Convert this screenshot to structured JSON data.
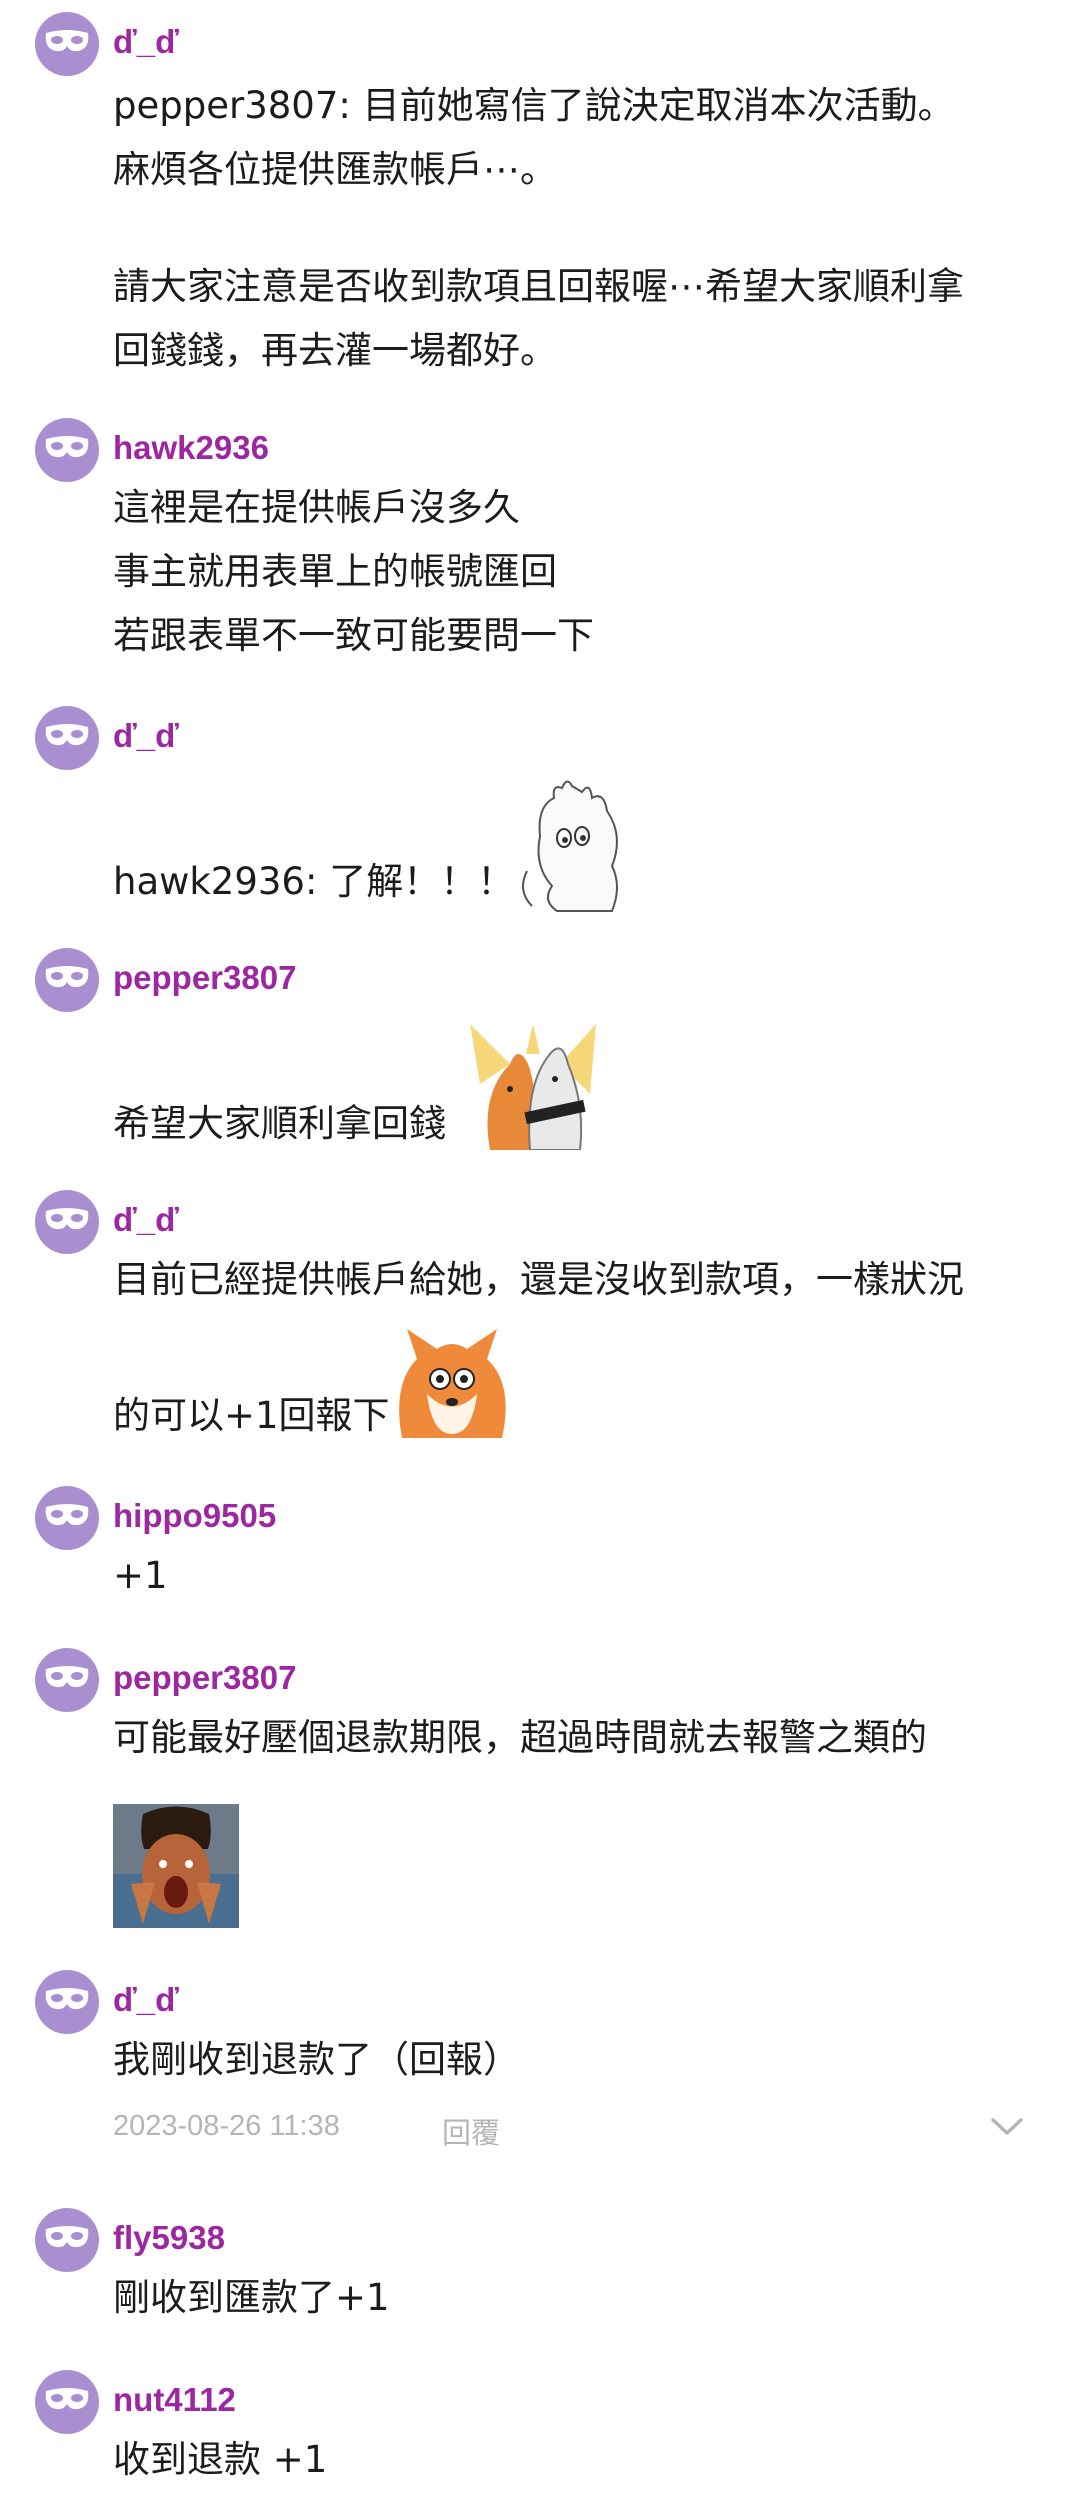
{
  "comments": [
    {
      "user": "ď_ď",
      "lines": [
        "pepper3807: 目前她寫信了說決定取消本次活動。",
        "麻煩各位提供匯款帳戶⋯。",
        "",
        "請大家注意是否收到款項且回報喔⋯希望大家順利拿",
        "回錢錢，再去灌一場都好。"
      ]
    },
    {
      "user": "hawk2936",
      "lines": [
        "這裡是在提供帳戶沒多久",
        "事主就用表單上的帳號匯回",
        "若跟表單不一致可能要問一下"
      ]
    },
    {
      "user": "ď_ď",
      "lines": [
        "hawk2936: 了解！！！"
      ],
      "sticker": "moomin-sticker"
    },
    {
      "user": "pepper3807",
      "lines": [
        "希望大家順利拿回錢"
      ],
      "sticker": "fox-dog-sticker"
    },
    {
      "user": "ď_ď",
      "lines": [
        "目前已經提供帳戶給她，還是沒收到款項，一樣狀況",
        "的可以+1回報下"
      ],
      "sticker": "fox-sticker"
    },
    {
      "user": "hippo9505",
      "lines": [
        "+1"
      ]
    },
    {
      "user": "pepper3807",
      "lines": [
        "可能最好壓個退款期限，超過時間就去報警之類的"
      ],
      "sticker": "shocked-face-image"
    },
    {
      "user": "ď_ď",
      "lines": [
        "我剛收到退款了（回報）"
      ],
      "timestamp": "2023-08-26 11:38",
      "reply_label": "回覆"
    },
    {
      "user": "fly5938",
      "lines": [
        "剛收到匯款了+1"
      ]
    },
    {
      "user": "nut4112",
      "lines": [
        "收到退款 +1"
      ]
    }
  ],
  "colors": {
    "username": "#9c27a0",
    "avatar": "#a98fcf",
    "text": "#1c1c1c",
    "meta": "#b5b5b5"
  },
  "icons": {
    "avatar": "mask-icon",
    "expand": "chevron-down-icon"
  }
}
